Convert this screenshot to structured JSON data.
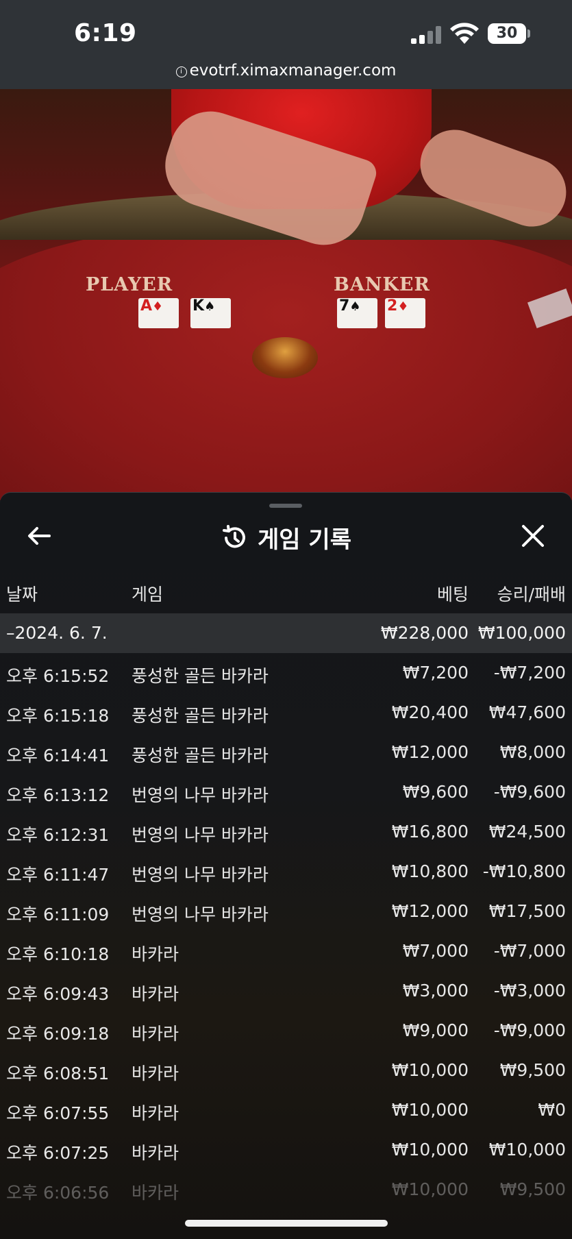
{
  "status_bar": {
    "time": "6:19",
    "battery": "30",
    "url": "evotrf.ximaxmanager.com"
  },
  "video": {
    "player_label": "PLAYER",
    "banker_label": "BANKER",
    "player_cards": [
      {
        "rank": "A",
        "suit": "♦",
        "color": "red"
      },
      {
        "rank": "K",
        "suit": "♠",
        "color": "black"
      }
    ],
    "banker_cards": [
      {
        "rank": "7",
        "suit": "♠",
        "color": "black"
      },
      {
        "rank": "2",
        "suit": "♦",
        "color": "red"
      }
    ]
  },
  "panel": {
    "title": "게임 기록",
    "back_icon": "arrow-left-icon",
    "close_icon": "close-icon",
    "history_icon": "history-icon",
    "columns": {
      "date": "날짜",
      "game": "게임",
      "bet": "베팅",
      "win_loss": "승리/패배"
    },
    "date_group": {
      "label": "–2024. 6. 7.",
      "bet_total": "₩228,000",
      "win_total": "₩100,000"
    },
    "rows": [
      {
        "time": "오후 6:15:52",
        "game": "풍성한 골든 바카라",
        "bet": "₩7,200",
        "result": "-₩7,200"
      },
      {
        "time": "오후 6:15:18",
        "game": "풍성한 골든 바카라",
        "bet": "₩20,400",
        "result": "₩47,600"
      },
      {
        "time": "오후 6:14:41",
        "game": "풍성한 골든 바카라",
        "bet": "₩12,000",
        "result": "₩8,000"
      },
      {
        "time": "오후 6:13:12",
        "game": "번영의 나무 바카라",
        "bet": "₩9,600",
        "result": "-₩9,600"
      },
      {
        "time": "오후 6:12:31",
        "game": "번영의 나무 바카라",
        "bet": "₩16,800",
        "result": "₩24,500"
      },
      {
        "time": "오후 6:11:47",
        "game": "번영의 나무 바카라",
        "bet": "₩10,800",
        "result": "-₩10,800"
      },
      {
        "time": "오후 6:11:09",
        "game": "번영의 나무 바카라",
        "bet": "₩12,000",
        "result": "₩17,500"
      },
      {
        "time": "오후 6:10:18",
        "game": "바카라",
        "bet": "₩7,000",
        "result": "-₩7,000"
      },
      {
        "time": "오후 6:09:43",
        "game": "바카라",
        "bet": "₩3,000",
        "result": "-₩3,000"
      },
      {
        "time": "오후 6:09:18",
        "game": "바카라",
        "bet": "₩9,000",
        "result": "-₩9,000"
      },
      {
        "time": "오후 6:08:51",
        "game": "바카라",
        "bet": "₩10,000",
        "result": "₩9,500"
      },
      {
        "time": "오후 6:07:55",
        "game": "바카라",
        "bet": "₩10,000",
        "result": "₩0"
      },
      {
        "time": "오후 6:07:25",
        "game": "바카라",
        "bet": "₩10,000",
        "result": "₩10,000"
      },
      {
        "time": "오후 6:06:56",
        "game": "바카라",
        "bet": "₩10,000",
        "result": "₩9,500"
      }
    ]
  }
}
